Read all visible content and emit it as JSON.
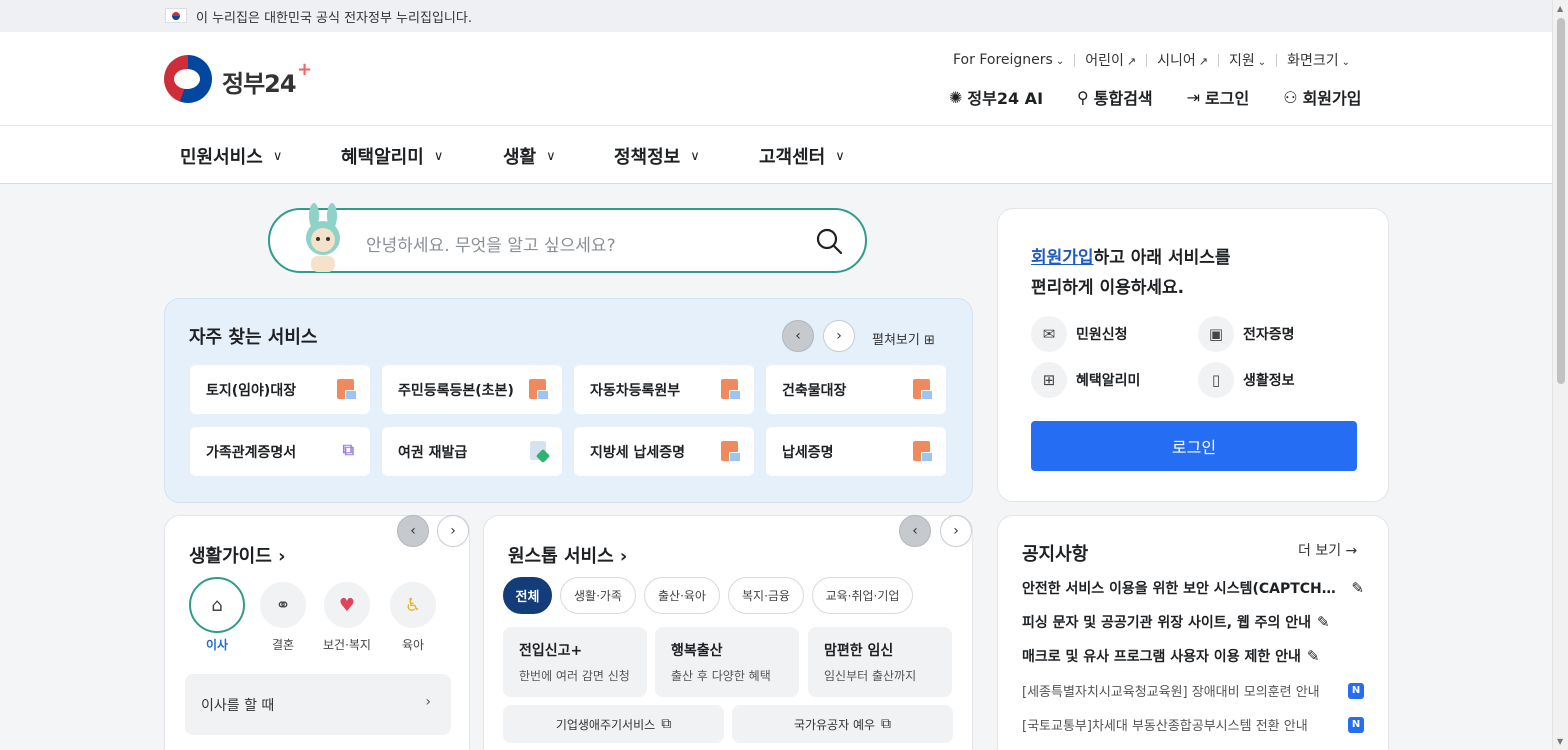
{
  "topbar": {
    "notice": "이 누리집은 대한민국 공식 전자정부 누리집입니다."
  },
  "header": {
    "logo_text": "정부24",
    "util": {
      "foreigners": "For Foreigners",
      "kids": "어린이",
      "senior": "시니어",
      "support": "지원",
      "font_size": "화면크기"
    },
    "main_util": {
      "ai": "정부24 AI",
      "search": "통합검색",
      "login": "로그인",
      "signup": "회원가입"
    }
  },
  "gnb": {
    "items": [
      "민원서비스",
      "혜택알리미",
      "생활",
      "정책정보",
      "고객센터"
    ]
  },
  "search": {
    "placeholder": "안녕하세요. 무엇을 알고 싶으세요?"
  },
  "frequent": {
    "title": "자주 찾는 서비스",
    "expand": "펼쳐보기",
    "items": [
      "토지(임야)대장",
      "주민등록등본(초본)",
      "자동차등록원부",
      "건축물대장",
      "가족관계증명서",
      "여권 재발급",
      "지방세 납세증명",
      "납세증명"
    ]
  },
  "life_guide": {
    "title": "생활가이드",
    "categories": [
      "이사",
      "결혼",
      "보건·복지",
      "육아"
    ],
    "selected": "이사",
    "box": "이사를 할 때"
  },
  "onestop": {
    "title": "원스톱 서비스",
    "chips": [
      "전체",
      "생활·가족",
      "출산·육아",
      "복지·금융",
      "교육·취업·기업"
    ],
    "boxes": [
      {
        "title": "전입신고+",
        "desc": "한번에 여러 감면 신청"
      },
      {
        "title": "행복출산",
        "desc": "출산 후 다양한 혜택"
      },
      {
        "title": "맘편한 임신",
        "desc": "임신부터 출산까지"
      }
    ],
    "links": [
      "기업생애주기서비스",
      "국가유공자 예우"
    ]
  },
  "login_panel": {
    "msg_link": "회원가입",
    "msg_rest": "하고 아래 서비스를",
    "msg_line2": "편리하게 이용하세요.",
    "services": [
      "민원신청",
      "전자증명",
      "혜택알리미",
      "생활정보"
    ],
    "button": "로그인"
  },
  "notice": {
    "title": "공지사항",
    "more": "더 보기",
    "items": [
      "안전한 서비스 이용을 위한 보안 시스템(CAPTCHA) 도입 안내",
      "피싱 문자 및 공공기관 위장 사이트, 웹 주의 안내",
      "매크로 및 유사 프로그램 사용자 이용 제한 안내",
      "[세종특별자치시교육청교육원] 장애대비 모의훈련 안내",
      "[국토교통부]차세대 부동산종합공부시스템 전환 안내"
    ],
    "new_badge": "N"
  },
  "colors": {
    "primary": "#256ef4",
    "accent_green": "#2f9c8a",
    "navy": "#123c7a"
  }
}
